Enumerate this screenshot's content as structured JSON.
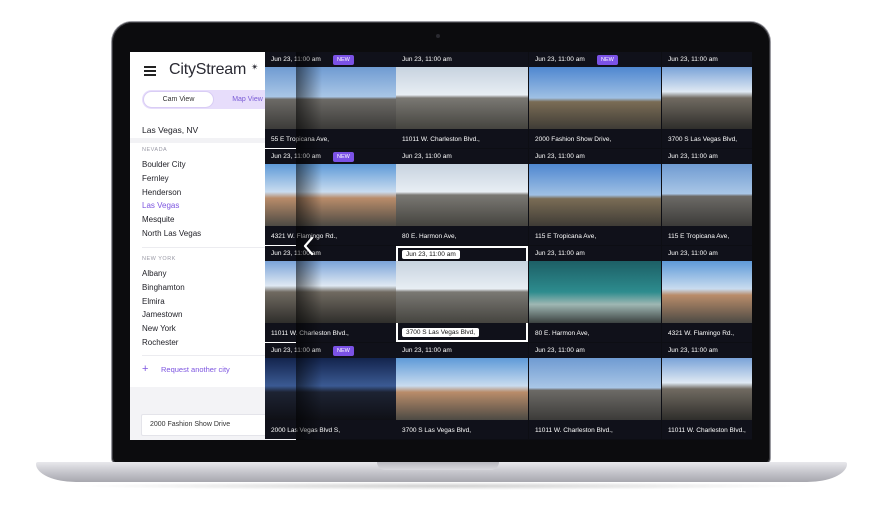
{
  "app": {
    "name": "CityStream",
    "mark": "✴"
  },
  "view_toggle": {
    "cam": "Cam View",
    "map": "Map View"
  },
  "city_select": {
    "value": "Las Vegas, NV"
  },
  "groups": [
    {
      "state": "NEVADA",
      "cities": [
        "Boulder City",
        "Fernley",
        "Henderson",
        "Las Vegas",
        "Mesquite",
        "North Las Vegas"
      ]
    },
    {
      "state": "NEW YORK",
      "cities": [
        "Albany",
        "Binghamton",
        "Elmira",
        "Jamestown",
        "New York",
        "Rochester"
      ]
    }
  ],
  "selected_city": "Las Vegas",
  "request_city": "Request another city",
  "address_box": "2000 Fashion Show Drive",
  "new_label": "NEW",
  "cameras": [
    {
      "ts": "Jun 23, 11:00 am",
      "addr": "55 E Tropicana Ave,",
      "new": true
    },
    {
      "ts": "Jun 23, 11:00 am",
      "addr": "11011 W. Charleston Blvd.,",
      "new": false
    },
    {
      "ts": "Jun 23, 11:00 am",
      "addr": "2000 Fashion Show Drive,",
      "new": true
    },
    {
      "ts": "Jun 23, 11:00 am",
      "addr": "3700 S Las Vegas Blvd,",
      "new": false
    },
    {
      "ts": "Jun 23, 11:00 am",
      "addr": "4321 W. Flamingo Rd.,",
      "new": true
    },
    {
      "ts": "Jun 23, 11:00 am",
      "addr": "80 E. Harmon Ave,",
      "new": false
    },
    {
      "ts": "Jun 23, 11:00 am",
      "addr": "115 E Tropicana Ave,",
      "new": false
    },
    {
      "ts": "Jun 23, 11:00 am",
      "addr": "115 E Tropicana Ave,",
      "new": false
    },
    {
      "ts": "Jun 23, 11:00 am",
      "addr": "11011 W. Charleston Blvd.,",
      "new": false
    },
    {
      "ts": "Jun 23, 11:00 am",
      "addr": "3700 S Las Vegas Blvd,",
      "new": false,
      "selected": true
    },
    {
      "ts": "Jun 23, 11:00 am",
      "addr": "80 E. Harmon Ave,",
      "new": false
    },
    {
      "ts": "Jun 23, 11:00 am",
      "addr": "4321 W. Flamingo Rd.,",
      "new": false
    },
    {
      "ts": "Jun 23, 11:00 am",
      "addr": "2000 Las Vegas Blvd S,",
      "new": true
    },
    {
      "ts": "Jun 23, 11:00 am",
      "addr": "3700 S Las Vegas Blvd,",
      "new": false
    },
    {
      "ts": "Jun 23, 11:00 am",
      "addr": "11011 W. Charleston Blvd.,",
      "new": false
    },
    {
      "ts": "Jun 23, 11:00 am",
      "addr": "11011 W. Charleston Blvd.,",
      "new": false
    }
  ],
  "colors": {
    "accent": "#7d55e0",
    "badge": "#7b52e6",
    "toggle_bg": "#e7ddfb",
    "grid_bg": "#0d0e14"
  },
  "icons": {
    "menu": "hamburger-icon",
    "chevron": "chevron-up-icon",
    "prev": "chevron-left-icon",
    "plus": "plus-icon"
  }
}
